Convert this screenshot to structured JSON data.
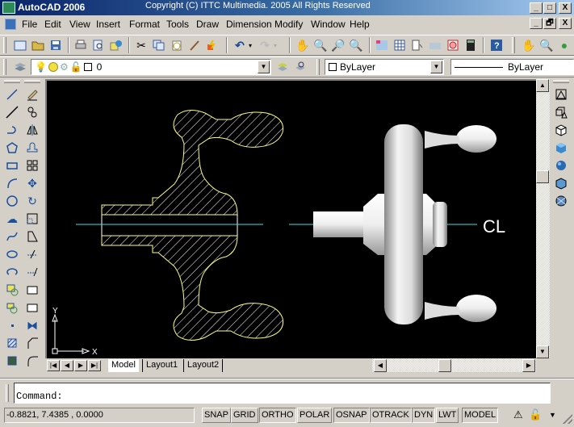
{
  "window": {
    "title": "AutoCAD 2006",
    "copyright": "Copyright (C) ITTC Multimedia. 2005 All Rights Reserved",
    "controls": {
      "minimize": "_",
      "maximize": "□",
      "close": "X",
      "restore": "🗗"
    }
  },
  "menu": {
    "items": [
      "File",
      "Edit",
      "View",
      "Insert",
      "Format",
      "Tools",
      "Draw",
      "Dimension",
      "Modify",
      "Window",
      "Help"
    ]
  },
  "standard_toolbar": {
    "icons": [
      "new-icon",
      "open-icon",
      "save-icon",
      "plot-icon",
      "plot-preview-icon",
      "publish-icon",
      "cut-icon",
      "copy-icon",
      "paste-icon",
      "match-properties-icon",
      "block-editor-icon",
      "undo-icon",
      "redo-icon",
      "pan-icon",
      "zoom-realtime-icon",
      "zoom-window-icon",
      "zoom-previous-icon",
      "properties-icon",
      "design-center-icon",
      "tool-palettes-icon",
      "sheet-set-icon",
      "markup-icon",
      "quickcalc-icon",
      "help-icon",
      "pan-icon-2",
      "zoom-icon-2",
      "orbit-icon"
    ]
  },
  "layers_toolbar": {
    "current_layer": "0",
    "color": "ByLayer",
    "linetype": "ByLayer"
  },
  "draw_toolbar": {
    "tools": [
      "line",
      "construction-line",
      "polyline",
      "polygon",
      "rectangle",
      "arc",
      "circle",
      "revision-cloud",
      "spline",
      "ellipse",
      "ellipse-arc",
      "insert-block",
      "make-block",
      "point",
      "hatch",
      "gradient"
    ]
  },
  "modify_toolbar": {
    "tools": [
      "erase",
      "copy",
      "mirror",
      "offset",
      "array",
      "move",
      "rotate",
      "scale",
      "stretch",
      "trim",
      "extend",
      "break-at-point",
      "break",
      "join",
      "chamfer",
      "fillet"
    ]
  },
  "solids_toolbar": {
    "tools": [
      "box-wire",
      "cone-wire",
      "box",
      "box-shaded",
      "sphere",
      "cube-shaded",
      "torus"
    ]
  },
  "drawing": {
    "ucs_x": "X",
    "ucs_y": "Y",
    "centerline_label": "CL",
    "colors": {
      "background": "#000000",
      "section_outline": "#ffff80",
      "hatch": "#ffffff",
      "centerline": "#40e0e0"
    }
  },
  "layout_tabs": [
    "Model",
    "Layout1",
    "Layout2"
  ],
  "active_tab": "Model",
  "command": {
    "prompt": "Command:"
  },
  "status": {
    "coordinates": "-0.8821, 7.4385 , 0.0000",
    "toggles": [
      {
        "label": "SNAP",
        "on": false
      },
      {
        "label": "GRID",
        "on": false
      },
      {
        "label": "ORTHO",
        "on": true
      },
      {
        "label": "POLAR",
        "on": false
      },
      {
        "label": "OSNAP",
        "on": true
      },
      {
        "label": "OTRACK",
        "on": true
      },
      {
        "label": "DYN",
        "on": true
      },
      {
        "label": "LWT",
        "on": false
      },
      {
        "label": "MODEL",
        "on": true
      }
    ]
  }
}
